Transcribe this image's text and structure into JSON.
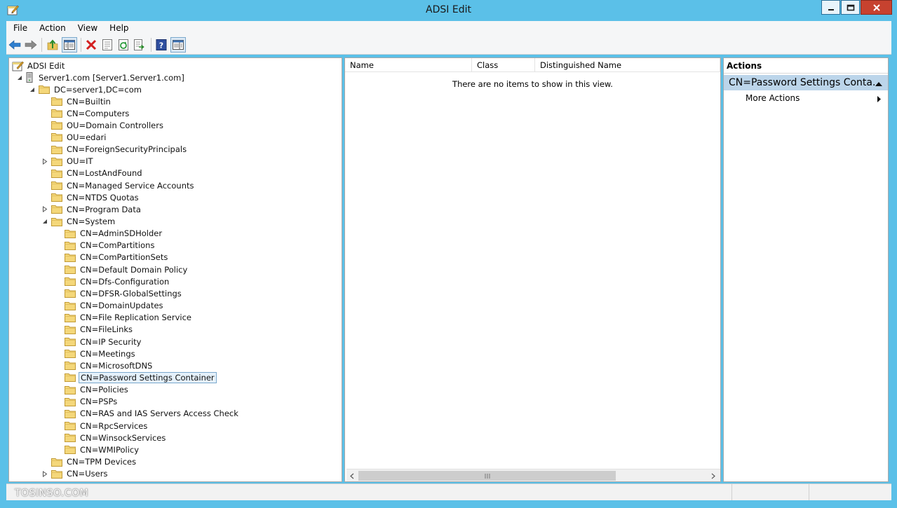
{
  "window": {
    "title": "ADSI Edit"
  },
  "menu": [
    "File",
    "Action",
    "View",
    "Help"
  ],
  "toolbar": {
    "icons": [
      "back-icon",
      "forward-icon",
      "up-level-icon",
      "show-hide-tree-icon",
      "delete-icon",
      "properties-icon",
      "refresh-icon",
      "export-list-icon",
      "help-icon",
      "show-hide-action-pane-icon"
    ]
  },
  "tree": {
    "root": "ADSI Edit",
    "server": "Server1.com [Server1.Server1.com]",
    "domain": "DC=server1,DC=com",
    "items": [
      {
        "label": "CN=Builtin",
        "level": 2,
        "expander": "none"
      },
      {
        "label": "CN=Computers",
        "level": 2,
        "expander": "none"
      },
      {
        "label": "OU=Domain Controllers",
        "level": 2,
        "expander": "none"
      },
      {
        "label": "OU=edari",
        "level": 2,
        "expander": "none"
      },
      {
        "label": "CN=ForeignSecurityPrincipals",
        "level": 2,
        "expander": "none"
      },
      {
        "label": "OU=IT",
        "level": 2,
        "expander": "collapsed"
      },
      {
        "label": "CN=LostAndFound",
        "level": 2,
        "expander": "none"
      },
      {
        "label": "CN=Managed Service Accounts",
        "level": 2,
        "expander": "none"
      },
      {
        "label": "CN=NTDS Quotas",
        "level": 2,
        "expander": "none"
      },
      {
        "label": "CN=Program Data",
        "level": 2,
        "expander": "collapsed"
      },
      {
        "label": "CN=System",
        "level": 2,
        "expander": "expanded"
      },
      {
        "label": "CN=AdminSDHolder",
        "level": 3,
        "expander": "none"
      },
      {
        "label": "CN=ComPartitions",
        "level": 3,
        "expander": "none"
      },
      {
        "label": "CN=ComPartitionSets",
        "level": 3,
        "expander": "none"
      },
      {
        "label": "CN=Default Domain Policy",
        "level": 3,
        "expander": "none"
      },
      {
        "label": "CN=Dfs-Configuration",
        "level": 3,
        "expander": "none"
      },
      {
        "label": "CN=DFSR-GlobalSettings",
        "level": 3,
        "expander": "none"
      },
      {
        "label": "CN=DomainUpdates",
        "level": 3,
        "expander": "none"
      },
      {
        "label": "CN=File Replication Service",
        "level": 3,
        "expander": "none"
      },
      {
        "label": "CN=FileLinks",
        "level": 3,
        "expander": "none"
      },
      {
        "label": "CN=IP Security",
        "level": 3,
        "expander": "none"
      },
      {
        "label": "CN=Meetings",
        "level": 3,
        "expander": "none"
      },
      {
        "label": "CN=MicrosoftDNS",
        "level": 3,
        "expander": "none"
      },
      {
        "label": "CN=Password Settings Container",
        "level": 3,
        "expander": "none",
        "selected": true
      },
      {
        "label": "CN=Policies",
        "level": 3,
        "expander": "none"
      },
      {
        "label": "CN=PSPs",
        "level": 3,
        "expander": "none"
      },
      {
        "label": "CN=RAS and IAS Servers Access Check",
        "level": 3,
        "expander": "none"
      },
      {
        "label": "CN=RpcServices",
        "level": 3,
        "expander": "none"
      },
      {
        "label": "CN=WinsockServices",
        "level": 3,
        "expander": "none"
      },
      {
        "label": "CN=WMIPolicy",
        "level": 3,
        "expander": "none"
      },
      {
        "label": "CN=TPM Devices",
        "level": 2,
        "expander": "none"
      },
      {
        "label": "CN=Users",
        "level": 2,
        "expander": "collapsed"
      }
    ]
  },
  "list": {
    "columns": [
      "Name",
      "Class",
      "Distinguished Name"
    ],
    "empty_message": "There are no items to show in this view."
  },
  "actions": {
    "header": "Actions",
    "section": "CN=Password Settings Conta...",
    "items": [
      "More Actions"
    ]
  },
  "status": {
    "watermark": "TOSINSO.COM"
  },
  "colors": {
    "titlebar": "#5bc0e8",
    "selection": "#e5f1fb",
    "action_section": "#bcd5ea",
    "close_button": "#c7422f"
  }
}
